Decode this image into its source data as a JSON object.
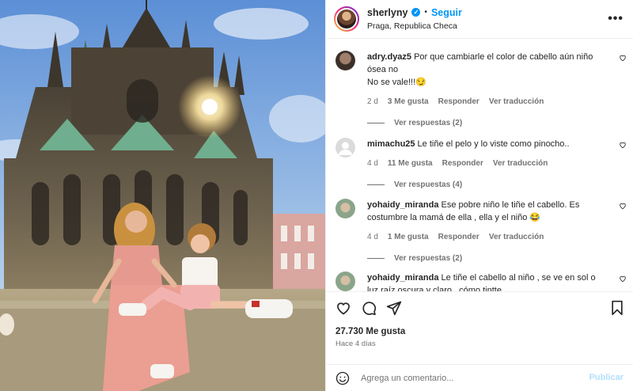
{
  "post": {
    "username": "sherlyny",
    "separator": "•",
    "follow_label": "Seguir",
    "location": "Praga, Republica Checa",
    "more_label": "•••"
  },
  "comments": [
    {
      "username": "adry.dyaz5",
      "text_line1": "Por que cambiarle el color de cabello aún niño",
      "text_line2": "ósea no",
      "text_line3": "No se vale!!!😏",
      "age": "2 d",
      "likes": "3 Me gusta",
      "reply_label": "Responder",
      "translate_label": "Ver traducción",
      "replies_label": "Ver respuestas (2)"
    },
    {
      "username": "mimachu25",
      "text_line1": "Le tiñe el pelo y lo viste como pinocho..",
      "age": "4 d",
      "likes": "11 Me gusta",
      "reply_label": "Responder",
      "translate_label": "Ver traducción",
      "replies_label": "Ver respuestas (4)"
    },
    {
      "username": "yohaidy_miranda",
      "text_line1": "Ese pobre niño le tiñe el cabello. Es",
      "text_line2": "costumbre la mamá de ella , ella y el niño 😂",
      "age": "4 d",
      "likes": "1 Me gusta",
      "reply_label": "Responder",
      "translate_label": "Ver traducción",
      "replies_label": "Ver respuestas (2)"
    },
    {
      "username": "yohaidy_miranda",
      "text_line1": "Le tiñe el cabello al niño , se ve en sol o",
      "text_line2": "luz raíz oscura y claro , cómo tintte"
    }
  ],
  "actions": {
    "icons": [
      "heart-icon",
      "comment-icon",
      "share-icon",
      "bookmark-icon"
    ]
  },
  "likes_count": "27.730 Me gusta",
  "posted_ago": "Hace 4 días",
  "composer": {
    "placeholder": "Agrega un comentario...",
    "publish_label": "Publicar"
  },
  "colors": {
    "accent": "#0095f6",
    "muted_text": "#737373",
    "publish_disabled": "#b2dffc"
  }
}
